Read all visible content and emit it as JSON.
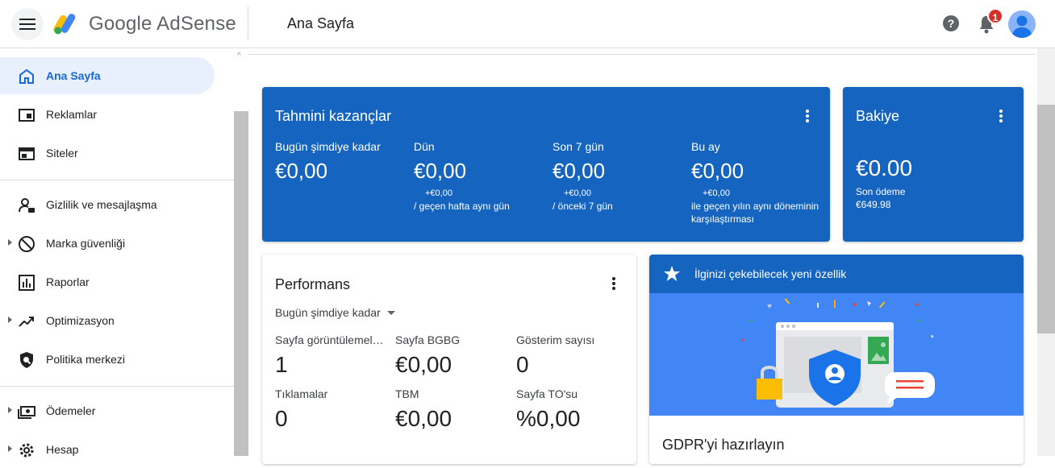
{
  "header": {
    "brand": "Google AdSense",
    "page_title": "Ana Sayfa",
    "notification_count": "1"
  },
  "sidebar": {
    "items": [
      {
        "label": "Ana Sayfa",
        "icon": "home-icon"
      },
      {
        "label": "Reklamlar",
        "icon": "ads-icon"
      },
      {
        "label": "Siteler",
        "icon": "sites-icon"
      },
      {
        "label": "Gizlilik ve mesajlaşma",
        "icon": "privacy-messaging-icon"
      },
      {
        "label": "Marka güvenliği",
        "icon": "block-icon"
      },
      {
        "label": "Raporlar",
        "icon": "reports-icon"
      },
      {
        "label": "Optimizasyon",
        "icon": "trending-up-icon"
      },
      {
        "label": "Politika merkezi",
        "icon": "policy-shield-icon"
      },
      {
        "label": "Ödemeler",
        "icon": "payments-icon"
      },
      {
        "label": "Hesap",
        "icon": "gear-icon"
      }
    ]
  },
  "estimated": {
    "title": "Tahmini kazançlar",
    "columns": [
      {
        "label": "Bugün şimdiye kadar",
        "value": "€0,00",
        "delta": "",
        "note": ""
      },
      {
        "label": "Dün",
        "value": "€0,00",
        "delta": "+€0,00",
        "note": "/ geçen hafta aynı gün"
      },
      {
        "label": "Son 7 gün",
        "value": "€0,00",
        "delta": "+€0,00",
        "note": "/ önceki 7 gün"
      },
      {
        "label": "Bu ay",
        "value": "€0,00",
        "delta": "+€0,00",
        "note": "ile geçen yılın aynı döneminin karşılaştırması"
      }
    ]
  },
  "balance": {
    "title": "Bakiye",
    "value": "€0.00",
    "last_payment_label": "Son ödeme",
    "last_payment_amount": "€649.98"
  },
  "performance": {
    "title": "Performans",
    "range": "Bugün şimdiye kadar",
    "metrics": [
      {
        "label": "Sayfa görüntülemeleri",
        "value": "1"
      },
      {
        "label": "Sayfa BGBG",
        "value": "€0,00"
      },
      {
        "label": "Gösterim sayısı",
        "value": "0"
      },
      {
        "label": "Tıklamalar",
        "value": "0"
      },
      {
        "label": "TBM",
        "value": "€0,00"
      },
      {
        "label": "Sayfa TO'su",
        "value": "%0,00"
      }
    ]
  },
  "feature": {
    "title": "İlginizi çekebilecek yeni özellik",
    "subtitle": "GDPR'yi hazırlayın"
  },
  "colors": {
    "card_blue": "#1565c0",
    "accent": "#1967d2",
    "badge": "#d93025"
  }
}
